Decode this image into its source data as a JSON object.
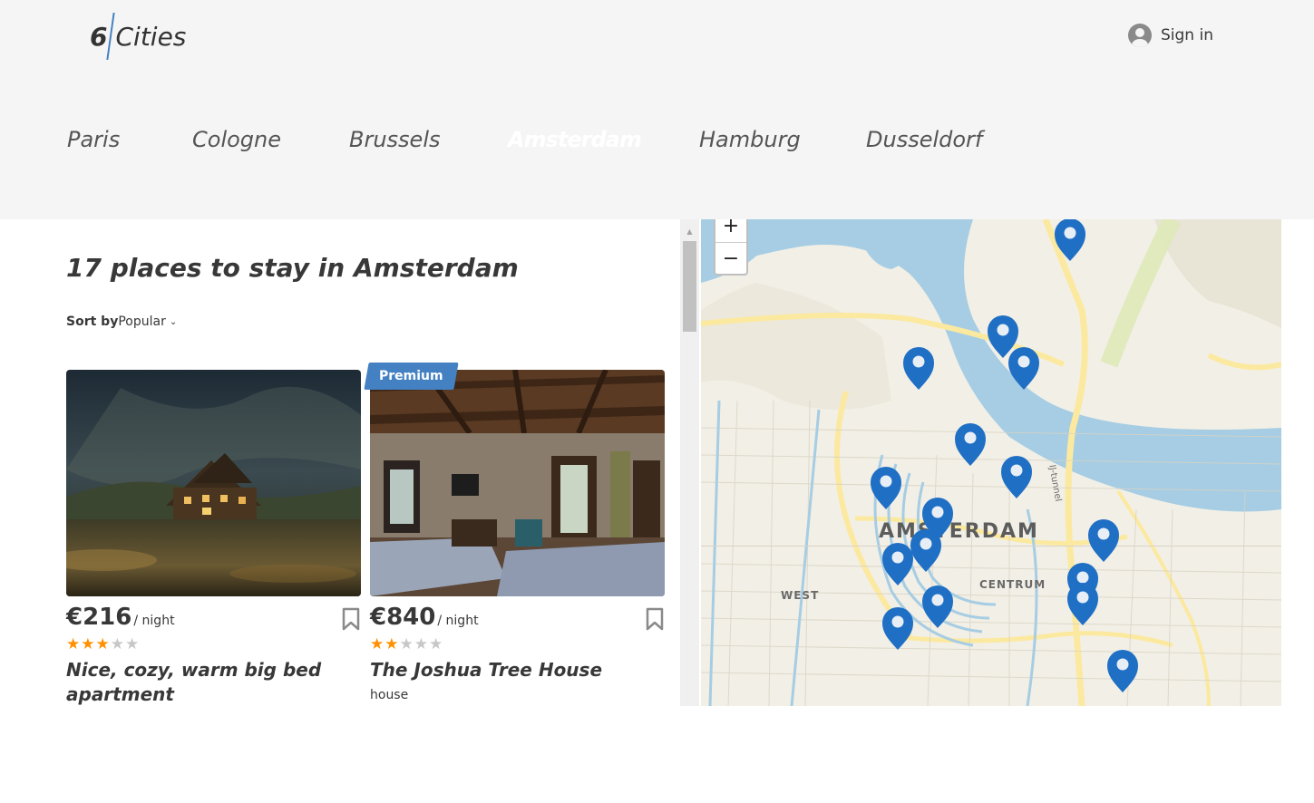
{
  "header": {
    "logo": {
      "number": "6",
      "word": "Cities"
    },
    "signin_label": "Sign in"
  },
  "tabs": [
    {
      "label": "Paris",
      "active": false
    },
    {
      "label": "Cologne",
      "active": false
    },
    {
      "label": "Brussels",
      "active": false
    },
    {
      "label": "Amsterdam",
      "active": true
    },
    {
      "label": "Hamburg",
      "active": false
    },
    {
      "label": "Dusseldorf",
      "active": false
    }
  ],
  "places": {
    "title": "17 places to stay in Amsterdam",
    "sort_label": "Sort by",
    "sort_value": "Popular"
  },
  "offers": [
    {
      "premium": false,
      "price": "€216",
      "per": "/ night",
      "rating": 3,
      "name": "Nice, cozy, warm big bed apartment",
      "type": ""
    },
    {
      "premium": true,
      "premium_label": "Premium",
      "price": "€840",
      "per": "/ night",
      "rating": 2,
      "name": "The Joshua Tree House",
      "type": "house"
    }
  ],
  "map": {
    "zoom_in": "+",
    "zoom_out": "−",
    "labels": {
      "city": "AMSTERDAM",
      "west": "WEST",
      "centrum": "CENTRUM",
      "tunnel": "IJ-tunnel"
    },
    "marker_count": 17
  },
  "colors": {
    "accent": "#4481c3",
    "star": "#ff9000",
    "header_bg": "#f5f5f5",
    "marker": "#1f6fc5"
  }
}
